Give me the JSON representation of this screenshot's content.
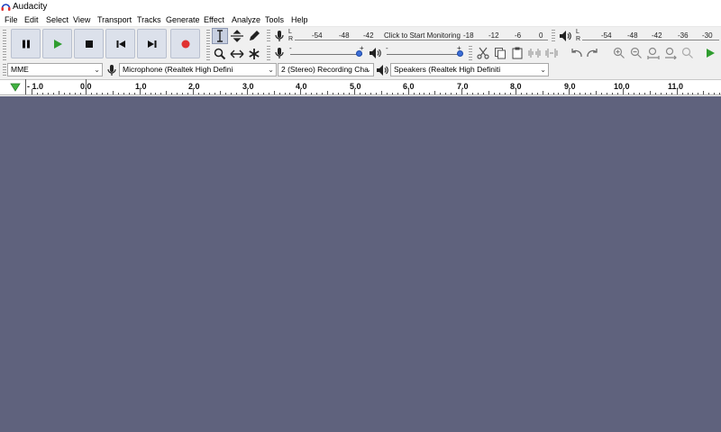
{
  "window": {
    "title": "Audacity"
  },
  "menu": [
    "File",
    "Edit",
    "Select",
    "View",
    "Transport",
    "Tracks",
    "Generate",
    "Effect",
    "Analyze",
    "Tools",
    "Help"
  ],
  "transport": {
    "buttons": [
      {
        "name": "pause-button",
        "icon": "pause-icon"
      },
      {
        "name": "play-button",
        "icon": "play-icon",
        "color": "#2f9d2f"
      },
      {
        "name": "stop-button",
        "icon": "stop-icon"
      },
      {
        "name": "skip-to-start-button",
        "icon": "skip-start-icon"
      },
      {
        "name": "skip-to-end-button",
        "icon": "skip-end-icon"
      },
      {
        "name": "record-button",
        "icon": "record-icon",
        "color": "#e03131"
      }
    ]
  },
  "tools": [
    "selection-tool",
    "envelope-tool",
    "draw-tool",
    "zoom-tool",
    "time-shift-tool",
    "multi-tool"
  ],
  "record_meter": {
    "channels": [
      "L",
      "R"
    ],
    "scale": [
      "-54",
      "-48",
      "-42",
      "-18",
      "-12",
      "-6",
      "0"
    ],
    "monitor_text": "Click to Start Monitoring"
  },
  "playback_meter": {
    "channels": [
      "L",
      "R"
    ],
    "scale": [
      "-54",
      "-48",
      "-42",
      "-36",
      "-30"
    ]
  },
  "mixer": {
    "record_minus": "-",
    "record_plus": "+",
    "playback_minus": "-",
    "playback_plus": "+"
  },
  "device": {
    "host": "MME",
    "input": "Microphone (Realtek High Defini",
    "channels": "2 (Stereo) Recording Cha",
    "output": "Speakers (Realtek High Definiti"
  },
  "timeline": {
    "labels": [
      "- 1.0",
      "0.0",
      "1.0",
      "2.0",
      "3.0",
      "4.0",
      "5.0",
      "6.0",
      "7.0",
      "8.0",
      "9.0",
      "10.0",
      "11.0"
    ]
  },
  "colors": {
    "track_area": "#5f627d",
    "accent_blue": "#3c6ed6",
    "play_green": "#2f9d2f",
    "record_red": "#e03131"
  }
}
